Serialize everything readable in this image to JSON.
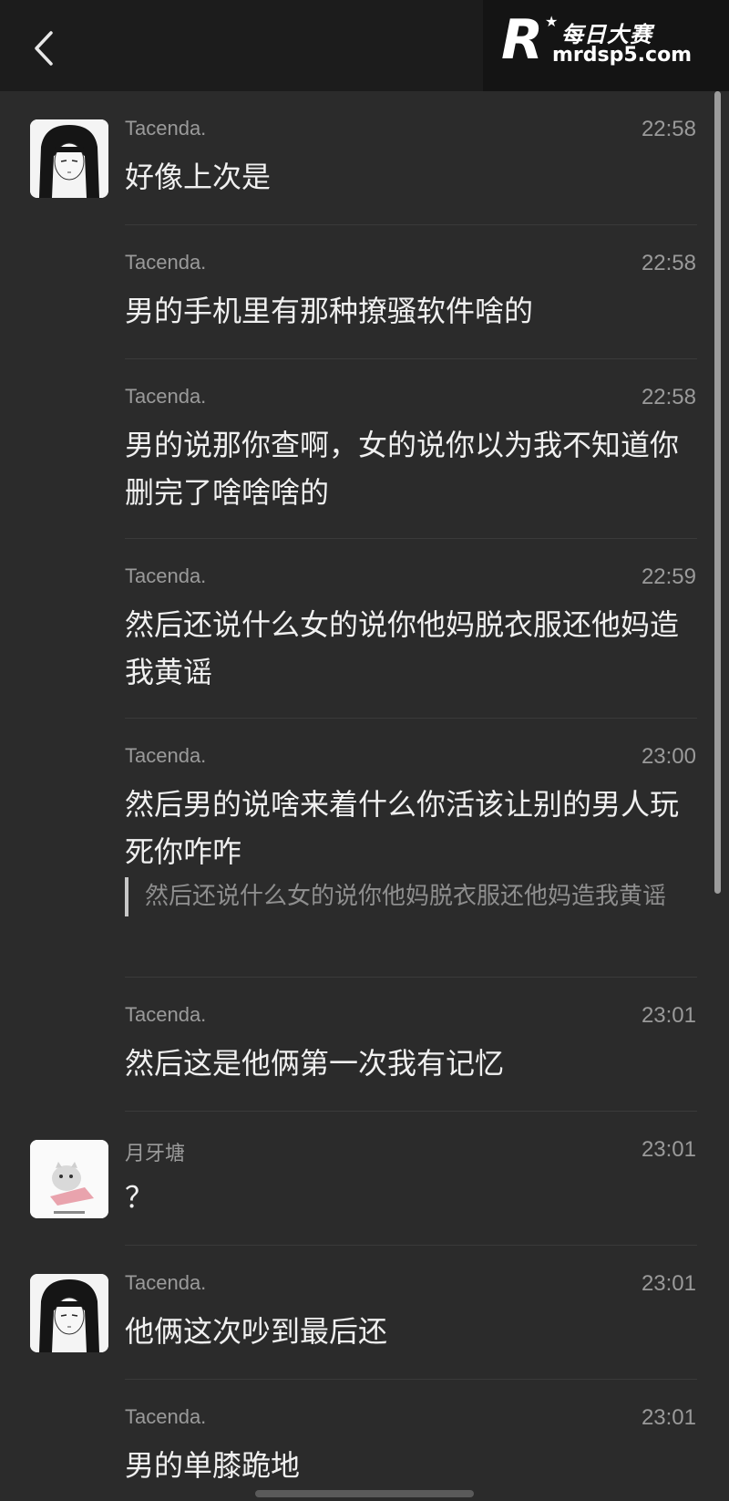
{
  "header": {
    "back_icon": "chevron-left-icon",
    "logo_letter": "R",
    "logo_star": "★",
    "logo_name": "每日大赛",
    "logo_url": "mrdsp5.com"
  },
  "messages": [
    {
      "sender": "Tacenda.",
      "time": "22:58",
      "text": "好像上次是"
    },
    {
      "sender": "Tacenda.",
      "time": "22:58",
      "text": "男的手机里有那种撩骚软件啥的"
    },
    {
      "sender": "Tacenda.",
      "time": "22:58",
      "text": "男的说那你查啊，女的说你以为我不知道你删完了啥啥啥的"
    },
    {
      "sender": "Tacenda.",
      "time": "22:59",
      "text": "然后还说什么女的说你他妈脱衣服还他妈造我黄谣"
    },
    {
      "sender": "Tacenda.",
      "time": "23:00",
      "text": "然后男的说啥来着什么你活该让别的男人玩死你咋咋",
      "quote": "然后还说什么女的说你他妈脱衣服还他妈造我黄谣"
    },
    {
      "sender": "Tacenda.",
      "time": "23:01",
      "text": "然后这是他俩第一次我有记忆"
    },
    {
      "sender": "月牙塘",
      "time": "23:01",
      "text": "？"
    },
    {
      "sender": "Tacenda.",
      "time": "23:01",
      "text": "他俩这次吵到最后还"
    },
    {
      "sender": "Tacenda.",
      "time": "23:01",
      "text": "男的单膝跪地"
    }
  ]
}
